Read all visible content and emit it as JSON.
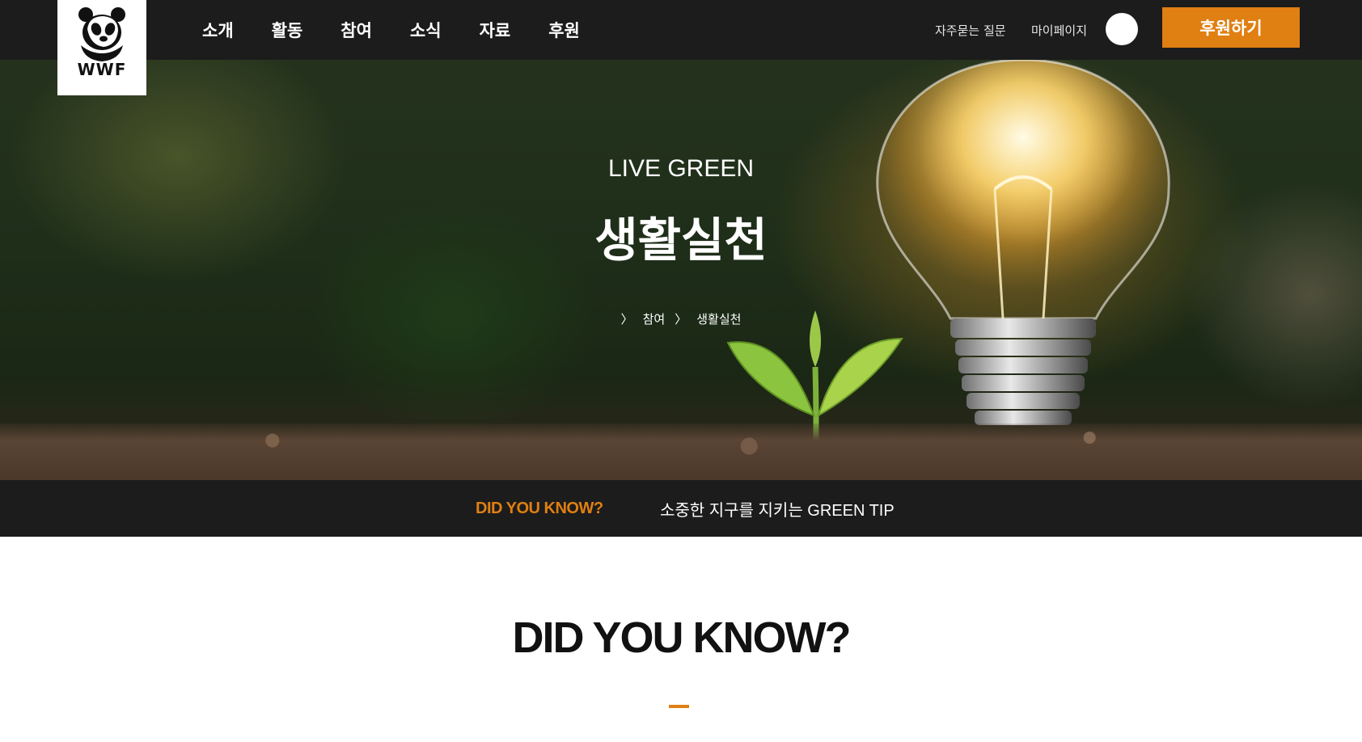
{
  "header": {
    "logo_text": "WWF",
    "nav": [
      "소개",
      "활동",
      "참여",
      "소식",
      "자료",
      "후원"
    ],
    "faq_label": "자주묻는 질문",
    "mypage_label": "마이페이지",
    "search_icon": "search-icon",
    "donate_label": "후원하기"
  },
  "hero": {
    "kicker": "LIVE GREEN",
    "title": "생활실천",
    "breadcrumb": {
      "separator": "〉",
      "items": [
        "참여",
        "생활실천"
      ]
    }
  },
  "band": {
    "label": "DID YOU KNOW?",
    "text": "소중한 지구를 지키는 GREEN TIP"
  },
  "section": {
    "title": "DID YOU KNOW?"
  },
  "colors": {
    "accent": "#e07f12",
    "header_bg": "#1c1c1c"
  }
}
